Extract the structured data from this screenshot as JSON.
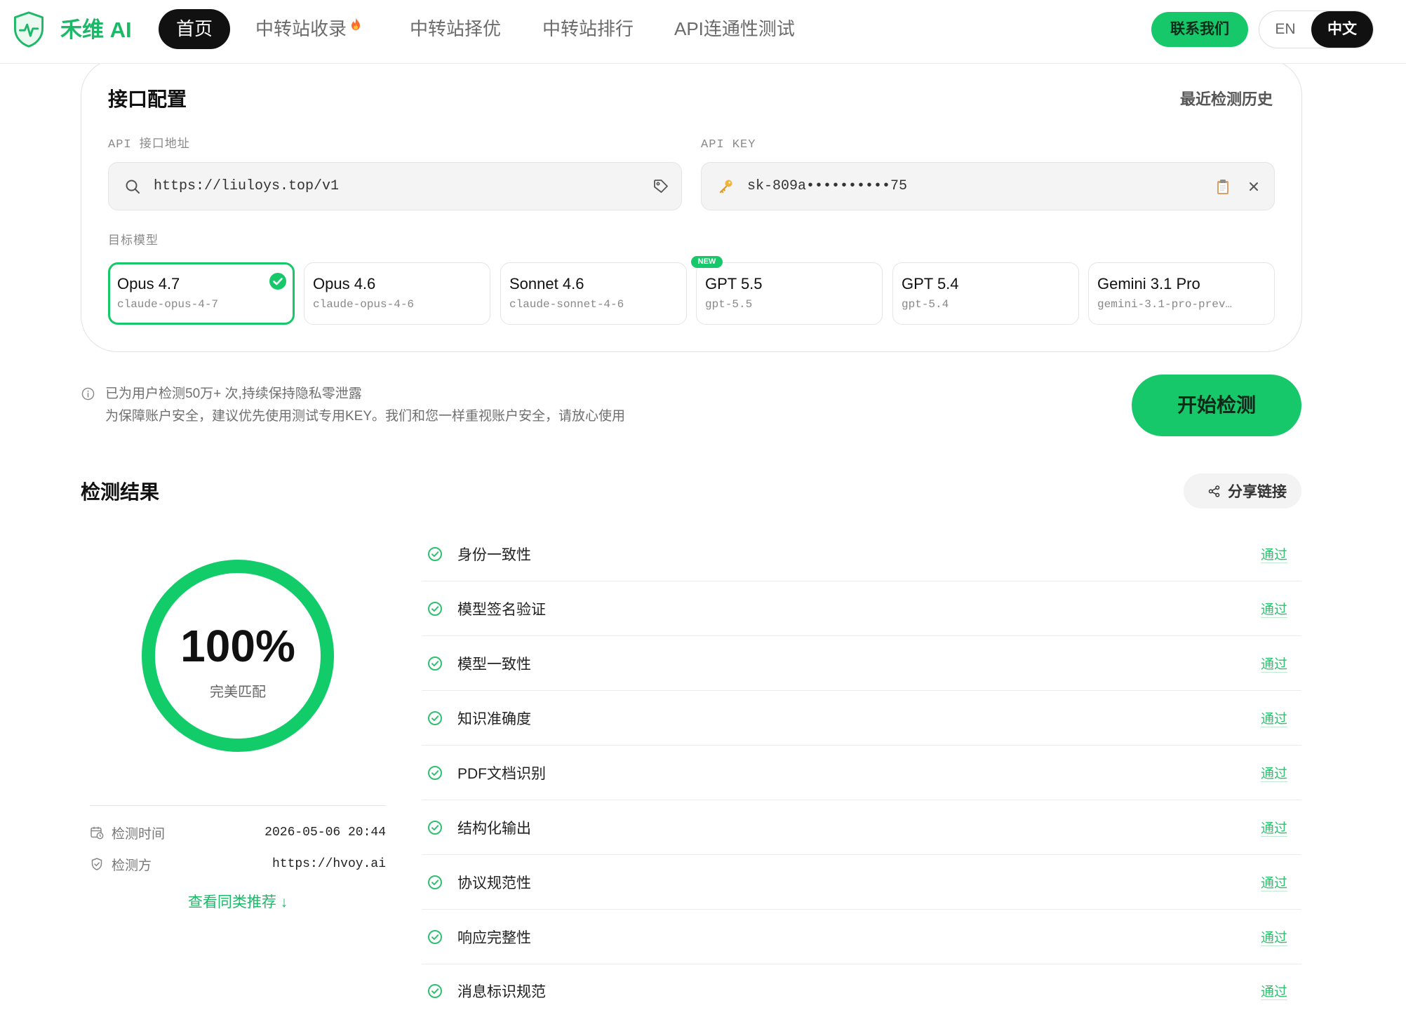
{
  "theme": {
    "primary": "#17c86a",
    "brand": "#1cb868",
    "pass": "#2fc06f",
    "dark": "#111111"
  },
  "header": {
    "brand": "禾维 AI",
    "logo_icon": "shield-pulse-icon",
    "nav": [
      {
        "label": "首页",
        "active": true
      },
      {
        "label": "中转站收录",
        "icon": "fire-icon"
      },
      {
        "label": "中转站择优"
      },
      {
        "label": "中转站排行"
      },
      {
        "label": "API连通性测试"
      }
    ],
    "contact_label": "联系我们",
    "lang": {
      "en": "EN",
      "zh": "中文",
      "active": "中文"
    }
  },
  "config": {
    "title": "接口配置",
    "history_label": "最近检测历史",
    "api_url": {
      "label": "API 接口地址",
      "value": "https://liuloys.top/v1"
    },
    "api_key": {
      "label": "API KEY",
      "value": "sk-809a••••••••••75"
    },
    "model_label": "目标模型",
    "models": [
      {
        "name": "Opus 4.7",
        "id": "claude-opus-4-7",
        "selected": true
      },
      {
        "name": "Opus 4.6",
        "id": "claude-opus-4-6"
      },
      {
        "name": "Sonnet 4.6",
        "id": "claude-sonnet-4-6"
      },
      {
        "name": "GPT 5.5",
        "id": "gpt-5.5",
        "badge": "NEW"
      },
      {
        "name": "GPT 5.4",
        "id": "gpt-5.4"
      },
      {
        "name": "Gemini 3.1 Pro",
        "id": "gemini-3.1-pro-prev…"
      }
    ]
  },
  "notice": {
    "line1": "已为用户检测50万+ 次,持续保持隐私零泄露",
    "line2": "为保障账户安全，建议优先使用测试专用KEY。我们和您一样重视账户安全，请放心使用"
  },
  "start_label": "开始检测",
  "results": {
    "title": "检测结果",
    "share_label": "分享链接",
    "score": {
      "text": "100%",
      "fraction": 1,
      "label": "完美匹配"
    },
    "meta": [
      {
        "label": "检测时间",
        "value": "2026-05-06 20:44",
        "icon": "calendar-clock-icon"
      },
      {
        "label": "检测方",
        "value": "https://hvoy.ai",
        "icon": "shield-check-icon"
      }
    ],
    "recommend_label": "查看同类推荐 ↓",
    "checks": [
      {
        "label": "身份一致性",
        "status": "通过"
      },
      {
        "label": "模型签名验证",
        "status": "通过"
      },
      {
        "label": "模型一致性",
        "status": "通过"
      },
      {
        "label": "知识准确度",
        "status": "通过"
      },
      {
        "label": "PDF文档识别",
        "status": "通过"
      },
      {
        "label": "结构化输出",
        "status": "通过"
      },
      {
        "label": "协议规范性",
        "status": "通过"
      },
      {
        "label": "响应完整性",
        "status": "通过"
      },
      {
        "label": "消息标识规范",
        "status": "通过"
      }
    ]
  }
}
